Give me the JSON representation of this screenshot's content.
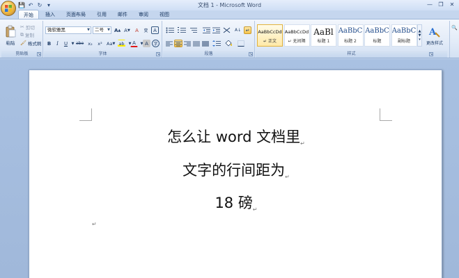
{
  "window": {
    "title": "文档 1 - Microsoft Word",
    "controls": {
      "minimize": "—",
      "maximize": "❐",
      "close": "✕"
    }
  },
  "quick_access": {
    "save": "💾",
    "undo": "↶",
    "redo": "↻",
    "customize": "▾"
  },
  "tabs": [
    "开始",
    "插入",
    "页面布局",
    "引用",
    "邮件",
    "审阅",
    "视图"
  ],
  "active_tab": "开始",
  "ribbon": {
    "clipboard": {
      "label": "剪贴板",
      "paste": "粘贴",
      "cut": "剪切",
      "copy": "复制",
      "format_painter": "格式刷"
    },
    "font": {
      "label": "字体",
      "font_name": "微软雅黑",
      "font_size": "二号",
      "grow": "A",
      "shrink": "A",
      "clear": "A",
      "phonetic": "变",
      "border": "A",
      "bold": "B",
      "italic": "I",
      "underline": "U",
      "strike": "abe",
      "subscript": "x₂",
      "superscript": "x²",
      "case": "Aa",
      "highlight": "ab",
      "font_color": "A",
      "shading": "A",
      "enclose": "字"
    },
    "paragraph": {
      "label": "段落",
      "sort": "A↓",
      "show_marks": "↵"
    },
    "styles": {
      "label": "样式",
      "items": [
        {
          "sample": "AaBbCcDd",
          "name": "↵ 正文",
          "selected": true
        },
        {
          "sample": "AaBbCcDd",
          "name": "↵ 无间隔",
          "selected": false
        },
        {
          "sample": "AaBl",
          "name": "标题 1",
          "selected": false
        },
        {
          "sample": "AaBbC",
          "name": "标题 2",
          "selected": false
        },
        {
          "sample": "AaBbC",
          "name": "标题",
          "selected": false
        },
        {
          "sample": "AaBbC",
          "name": "副标题",
          "selected": false
        }
      ],
      "change_styles": "更改样式"
    }
  },
  "document": {
    "lines": [
      "怎么让 word 文档里",
      "文字的行间距为",
      "18 磅"
    ],
    "paragraph_mark": "↵"
  },
  "colors": {
    "accent": "#e2b33c",
    "ribbon": "#dfe9f7",
    "workspace": "#a9c1e2"
  }
}
